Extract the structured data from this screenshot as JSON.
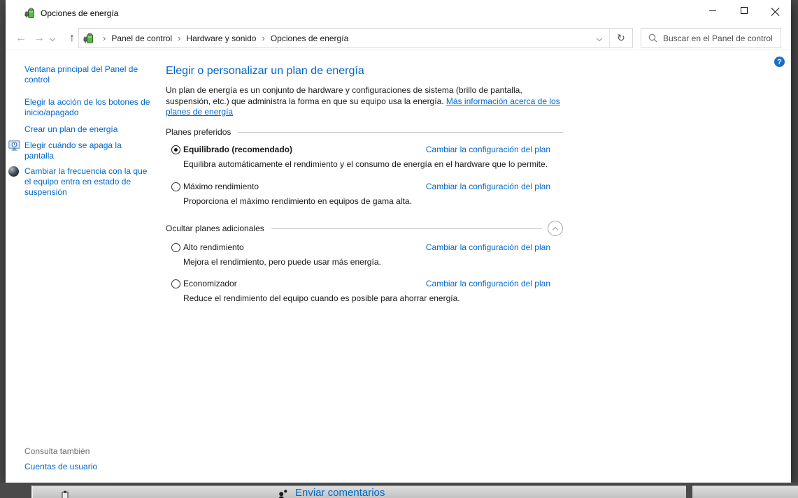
{
  "window": {
    "title": "Opciones de energía"
  },
  "navbar": {
    "icons": {
      "back": "←",
      "forward": "→",
      "up": "↑",
      "refresh": "↻"
    },
    "breadcrumb": [
      "Panel de control",
      "Hardware y sonido",
      "Opciones de energía"
    ],
    "breadcrumb_separator": "›",
    "search_placeholder": "Buscar en el Panel de control"
  },
  "help": {
    "label": "?"
  },
  "sidebar": {
    "items": [
      {
        "label": "Ventana principal del Panel de control"
      },
      {
        "label": "Elegir la acción de los botones de inicio/apagado"
      },
      {
        "label": "Crear un plan de energía"
      },
      {
        "label": "Elegir cuándo se apaga la pantalla",
        "icon": "display-clock-icon"
      },
      {
        "label": "Cambiar la frecuencia con la que el equipo entra en estado de suspensión",
        "icon": "sleep-sphere-icon"
      }
    ],
    "see_also_header": "Consulta también",
    "see_also_link": "Cuentas de usuario"
  },
  "main": {
    "title": "Elegir o personalizar un plan de energía",
    "intro_text": "Un plan de energía es un conjunto de hardware y configuraciones de sistema (brillo de pantalla, suspensión, etc.) que administra la forma en que su equipo usa la energía. ",
    "intro_link": "Más información acerca de los planes de energía",
    "sections": [
      {
        "header": "Planes preferidos",
        "plans": [
          {
            "name": "Equilibrado (recomendado)",
            "selected": true,
            "description": "Equilibra automáticamente el rendimiento y el consumo de energía en el hardware que lo permite.",
            "link": "Cambiar la configuración del plan"
          },
          {
            "name": "Máximo rendimiento",
            "selected": false,
            "description": "Proporciona el máximo rendimiento en equipos de gama alta.",
            "link": "Cambiar la configuración del plan"
          }
        ]
      },
      {
        "header": "Ocultar planes adicionales",
        "plans": [
          {
            "name": "Alto rendimiento",
            "selected": false,
            "description": "Mejora el rendimiento, pero puede usar más energía.",
            "link": "Cambiar la configuración del plan"
          },
          {
            "name": "Economizador",
            "selected": false,
            "description": "Reduce el rendimiento del equipo cuando es posible para ahorrar energía.",
            "link": "Cambiar la configuración del plan"
          }
        ]
      }
    ]
  },
  "background": {
    "feedback_link": "Enviar comentarios"
  },
  "colors": {
    "link_blue": "#0066cc",
    "heading_blue": "#0066cc",
    "desktop_gray": "#4a4a4a",
    "help_badge_blue": "#1b6ec2",
    "feedback_blue": "#0069c0"
  }
}
